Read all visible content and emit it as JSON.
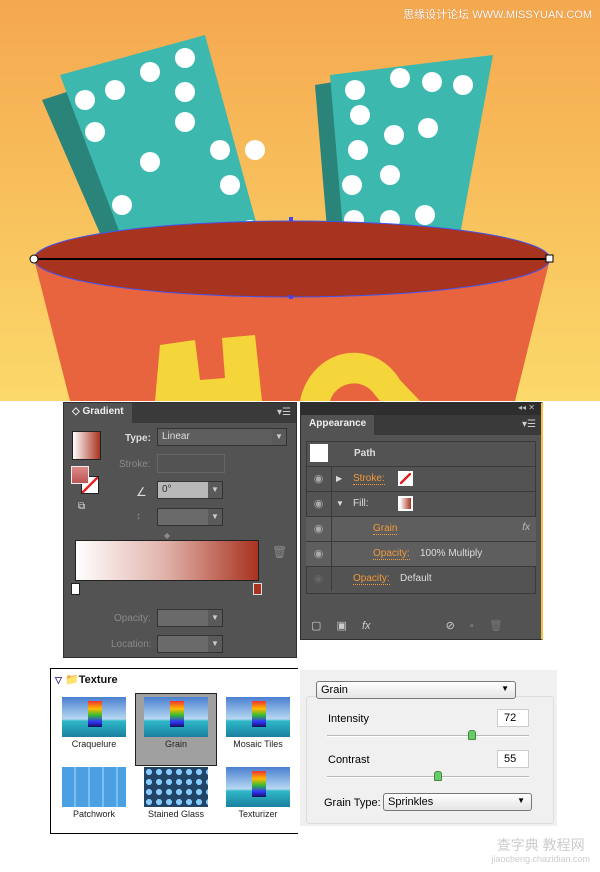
{
  "watermark_top": "思缘设计论坛 WWW.MISSYUAN.COM",
  "watermark_bottom": {
    "main": "查字典 教程网",
    "sub": "jiaocheng.chazidian.com"
  },
  "artwork": {
    "colors": {
      "bg_top": "#f5a84f",
      "bg_bottom": "#fbd96a",
      "teal": "#3cb8ae",
      "teal_dark": "#2a8479",
      "bucket": "#e8643f",
      "bucket_inner": "#a8331f",
      "yellow": "#f5d63a"
    }
  },
  "gradient_panel": {
    "title": "Gradient",
    "type_label": "Type:",
    "type_value": "Linear",
    "stroke_label": "Stroke:",
    "angle_value": "0°",
    "opacity_label": "Opacity:",
    "location_label": "Location:",
    "start_color": "#ffffff",
    "end_color": "#a8331f"
  },
  "appearance_panel": {
    "title": "Appearance",
    "object": "Path",
    "rows": [
      {
        "label": "Stroke:",
        "value": ""
      },
      {
        "label": "Fill:",
        "value": ""
      },
      {
        "label": "Grain",
        "value": "",
        "fx": "fx"
      },
      {
        "label": "Opacity:",
        "value": "100% Multiply"
      },
      {
        "label": "Opacity:",
        "value": "Default"
      }
    ],
    "fx_button": "fx"
  },
  "texture_panel": {
    "folder": "Texture",
    "items": [
      "Craquelure",
      "Grain",
      "Mosaic Tiles",
      "Patchwork",
      "Stained Glass",
      "Texturizer"
    ],
    "selected": "Grain"
  },
  "grain_panel": {
    "filter": "Grain",
    "intensity_label": "Intensity",
    "intensity": 72,
    "contrast_label": "Contrast",
    "contrast": 55,
    "grain_type_label": "Grain Type:",
    "grain_type": "Sprinkles"
  }
}
